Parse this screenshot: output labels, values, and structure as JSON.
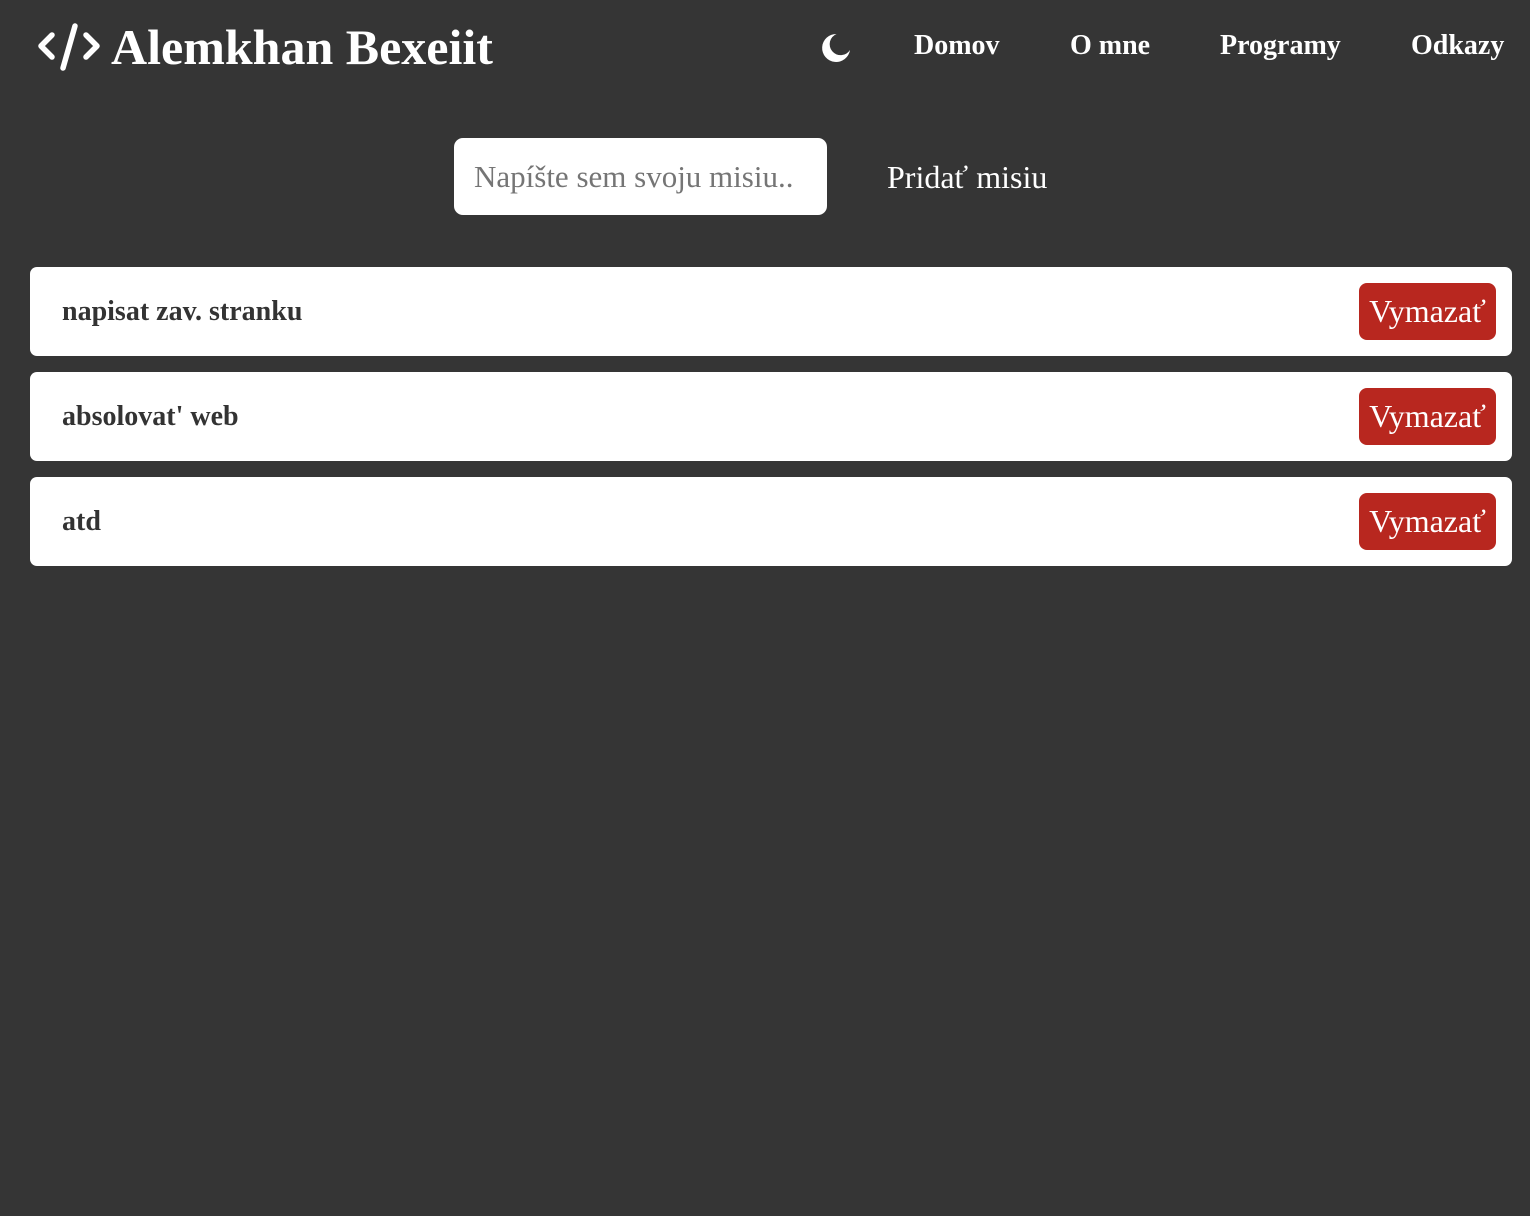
{
  "header": {
    "logo_text": "Alemkhan Bexeiit",
    "logo_icon": "code-icon",
    "theme_toggle_icon": "moon-icon",
    "nav": [
      {
        "label": "Domov"
      },
      {
        "label": "O mne"
      },
      {
        "label": "Programy"
      },
      {
        "label": "Odkazy"
      }
    ]
  },
  "form": {
    "input_value": "",
    "input_placeholder": "Napíšte sem svoju misiu..",
    "add_label": "Pridať misiu"
  },
  "missions": [
    {
      "text": "napisat zav. stranku",
      "delete_label": "Vymazať"
    },
    {
      "text": "absolovat' web",
      "delete_label": "Vymazať"
    },
    {
      "text": "atd",
      "delete_label": "Vymazať"
    }
  ],
  "colors": {
    "background": "#353535",
    "card": "#ffffff",
    "card_text": "#333333",
    "delete": "#b8271f",
    "text": "#ffffff"
  }
}
